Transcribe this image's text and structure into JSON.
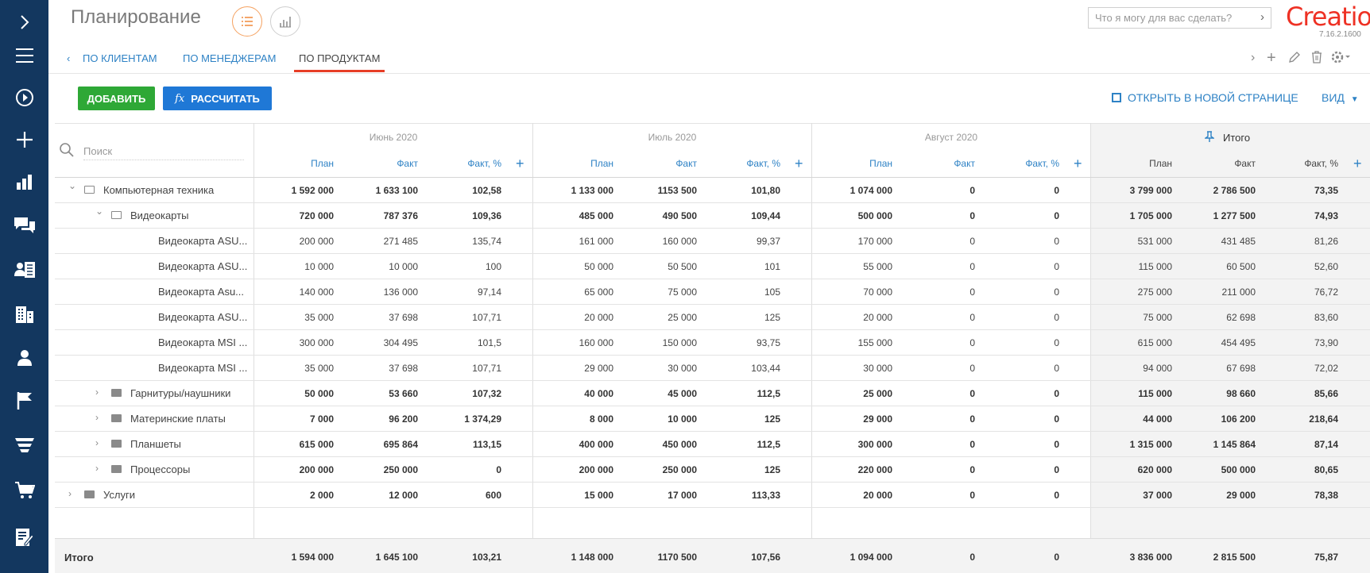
{
  "app": {
    "title": "Планирование",
    "version": "7.16.2.1600",
    "logo": "Creatio"
  },
  "command": {
    "placeholder": "Что я могу для вас сделать?"
  },
  "tabs": [
    {
      "label": "ПО КЛИЕНТАМ"
    },
    {
      "label": "ПО МЕНЕДЖЕРАМ"
    },
    {
      "label": "ПО ПРОДУКТАМ"
    }
  ],
  "toolbar": {
    "add_label": "ДОБАВИТЬ",
    "calc_label": "РАССЧИТАТЬ",
    "calc_icon": "fx",
    "open_new_label": "ОТКРЫТЬ В НОВОЙ СТРАНИЦЕ",
    "view_label": "ВИД"
  },
  "search": {
    "placeholder": "Поиск"
  },
  "months": [
    "Июнь 2020",
    "Июль 2020",
    "Август 2020"
  ],
  "totals_header": "Итого",
  "subheaders": {
    "plan": "План",
    "fact": "Факт",
    "fact_pct": "Факт, %"
  },
  "rows": [
    {
      "name": "Компьютерная техника",
      "level": 0,
      "type": "folder-open",
      "bold": true,
      "v": [
        "1 592 000",
        "1 633 100",
        "102,58",
        "1 133 000",
        "1153 500",
        "101,80",
        "1 074 000",
        "0",
        "0",
        "3 799 000",
        "2 786 500",
        "73,35"
      ]
    },
    {
      "name": "Видеокарты",
      "level": 1,
      "type": "folder-open",
      "bold": true,
      "v": [
        "720 000",
        "787 376",
        "109,36",
        "485 000",
        "490 500",
        "109,44",
        "500 000",
        "0",
        "0",
        "1 705 000",
        "1 277 500",
        "74,93"
      ]
    },
    {
      "name": "Видеокарта ASU...",
      "level": 2,
      "type": "item",
      "bold": false,
      "v": [
        "200 000",
        "271 485",
        "135,74",
        "161 000",
        "160 000",
        "99,37",
        "170 000",
        "0",
        "0",
        "531 000",
        "431 485",
        "81,26"
      ]
    },
    {
      "name": "Видеокарта ASU...",
      "level": 2,
      "type": "item",
      "bold": false,
      "v": [
        "10 000",
        "10 000",
        "100",
        "50 000",
        "50 500",
        "101",
        "55 000",
        "0",
        "0",
        "115 000",
        "60 500",
        "52,60"
      ]
    },
    {
      "name": "Видеокарта Asu...",
      "level": 2,
      "type": "item",
      "bold": false,
      "v": [
        "140 000",
        "136 000",
        "97,14",
        "65 000",
        "75 000",
        "105",
        "70 000",
        "0",
        "0",
        "275 000",
        "211 000",
        "76,72"
      ]
    },
    {
      "name": "Видеокарта ASU...",
      "level": 2,
      "type": "item",
      "bold": false,
      "v": [
        "35 000",
        "37 698",
        "107,71",
        "20 000",
        "25 000",
        "125",
        "20 000",
        "0",
        "0",
        "75 000",
        "62 698",
        "83,60"
      ]
    },
    {
      "name": "Видеокарта MSI ...",
      "level": 2,
      "type": "item",
      "bold": false,
      "v": [
        "300 000",
        "304 495",
        "101,5",
        "160 000",
        "150 000",
        "93,75",
        "155 000",
        "0",
        "0",
        "615 000",
        "454 495",
        "73,90"
      ]
    },
    {
      "name": "Видеокарта MSI ...",
      "level": 2,
      "type": "item",
      "bold": false,
      "v": [
        "35 000",
        "37 698",
        "107,71",
        "29 000",
        "30 000",
        "103,44",
        "30 000",
        "0",
        "0",
        "94 000",
        "67 698",
        "72,02"
      ]
    },
    {
      "name": "Гарнитуры/наушники",
      "level": 1,
      "type": "folder-closed",
      "bold": true,
      "v": [
        "50 000",
        "53 660",
        "107,32",
        "40 000",
        "45 000",
        "112,5",
        "25 000",
        "0",
        "0",
        "115 000",
        "98 660",
        "85,66"
      ]
    },
    {
      "name": "Материнские платы",
      "level": 1,
      "type": "folder-closed",
      "bold": true,
      "v": [
        "7 000",
        "96 200",
        "1 374,29",
        "8 000",
        "10 000",
        "125",
        "29 000",
        "0",
        "0",
        "44 000",
        "106 200",
        "218,64"
      ]
    },
    {
      "name": "Планшеты",
      "level": 1,
      "type": "folder-closed",
      "bold": true,
      "v": [
        "615 000",
        "695 864",
        "113,15",
        "400 000",
        "450 000",
        "112,5",
        "300 000",
        "0",
        "0",
        "1 315 000",
        "1 145 864",
        "87,14"
      ]
    },
    {
      "name": "Процессоры",
      "level": 1,
      "type": "folder-closed",
      "bold": true,
      "v": [
        "200 000",
        "250 000",
        "0",
        "200 000",
        "250 000",
        "125",
        "220 000",
        "0",
        "0",
        "620 000",
        "500 000",
        "80,65"
      ]
    },
    {
      "name": "Услуги",
      "level": 0,
      "type": "folder-closed",
      "bold": true,
      "v": [
        "2 000",
        "12 000",
        "600",
        "15 000",
        "17 000",
        "113,33",
        "20 000",
        "0",
        "0",
        "37 000",
        "29 000",
        "78,38"
      ]
    }
  ],
  "total": {
    "label": "Итого",
    "v": [
      "1 594 000",
      "1 645 100",
      "103,21",
      "1 148 000",
      "1170 500",
      "107,56",
      "1 094 000",
      "0",
      "0",
      "3 836 000",
      "2 815 500",
      "75,87"
    ]
  },
  "sidebar_icons": [
    "chevron-right-icon",
    "menu-icon",
    "play-icon",
    "plus-icon",
    "chart-icon",
    "chat-icon",
    "contact-card-icon",
    "building-icon",
    "user-icon",
    "flag-icon",
    "funnel-icon",
    "cart-icon",
    "edit-document-icon"
  ],
  "colors": {
    "sidebar": "#13375f",
    "accent": "#2e82c5",
    "add": "#2ea836",
    "calc": "#1f78d6",
    "active_tab": "#e73d26",
    "logo": "#ee3124"
  }
}
